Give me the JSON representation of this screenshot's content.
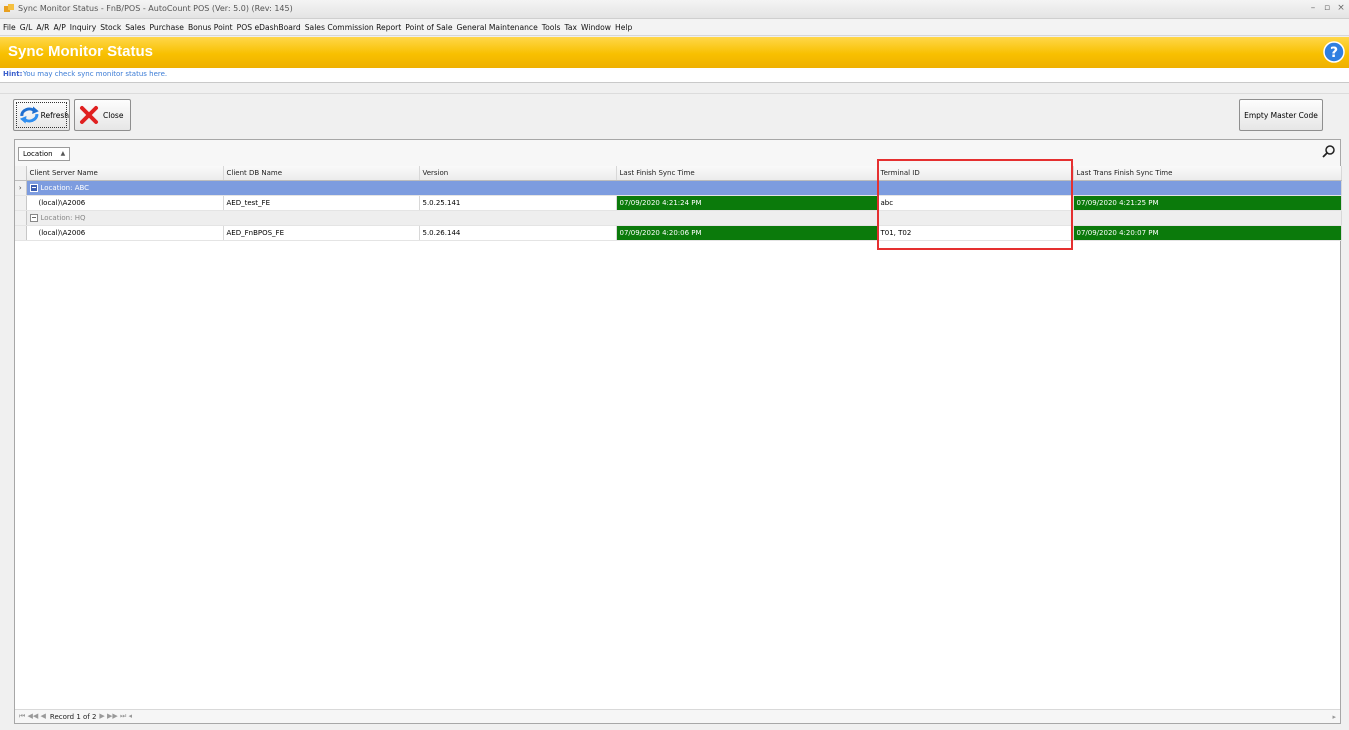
{
  "window": {
    "title": "Sync Monitor Status - FnB/POS - AutoCount POS (Ver: 5.0) (Rev: 145)"
  },
  "menu": [
    "File",
    "G/L",
    "A/R",
    "A/P",
    "Inquiry",
    "Stock",
    "Sales",
    "Purchase",
    "Bonus Point",
    "POS eDashBoard",
    "Sales Commission Report",
    "Point of Sale",
    "General Maintenance",
    "Tools",
    "Tax",
    "Window",
    "Help"
  ],
  "header": {
    "title": "Sync Monitor Status"
  },
  "hint": {
    "label": "Hint:",
    "text": "You may check sync monitor status here."
  },
  "toolbar": {
    "refresh": "Refresh",
    "close": "Close",
    "empty_master": "Empty Master Code"
  },
  "group_panel": {
    "chip": "Location"
  },
  "columns": [
    "Client Server Name",
    "Client DB Name",
    "Version",
    "Last Finish Sync Time",
    "Terminal ID",
    "Last Trans Finish Sync Time"
  ],
  "groups": [
    {
      "label": "Location: ABC",
      "rows": [
        {
          "server": "(local)\\A2006",
          "db": "AED_test_FE",
          "version": "5.0.25.141",
          "last_sync": "07/09/2020 4:21:24 PM",
          "terminal": "abc",
          "last_trans": "07/09/2020 4:21:25 PM"
        }
      ]
    },
    {
      "label": "Location: HQ",
      "rows": [
        {
          "server": "(local)\\A2006",
          "db": "AED_FnBPOS_FE",
          "version": "5.0.26.144",
          "last_sync": "07/09/2020 4:20:06 PM",
          "terminal": "T01, T02",
          "last_trans": "07/09/2020 4:20:07 PM"
        }
      ]
    }
  ],
  "navigator": {
    "record_text": "Record 1 of 2"
  },
  "colors": {
    "header_yellow": "#f8c000",
    "selected_group": "#7d9cdf",
    "sync_green": "#0b7a0b",
    "highlight": "#e53030"
  }
}
